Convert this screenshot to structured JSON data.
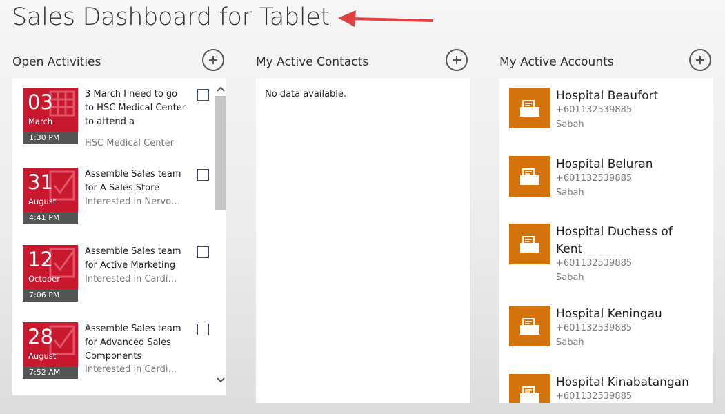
{
  "page": {
    "title": "Sales Dashboard for Tablet"
  },
  "columns": {
    "activities": {
      "header": "Open Activities",
      "items": [
        {
          "day": "03",
          "month": "March",
          "time": "1:30 PM",
          "title": "3 March I need to go to HSC Medical Center to attend a",
          "subtitle": "HSC Medical Center"
        },
        {
          "day": "31",
          "month": "August",
          "time": "4:41 PM",
          "title": "Assemble Sales team for A Sales Store",
          "subtitle": "Interested in Nervous"
        },
        {
          "day": "12",
          "month": "October",
          "time": "7:06 PM",
          "title": "Assemble Sales team for Active Marketing",
          "subtitle": "Interested in Cardiology"
        },
        {
          "day": "28",
          "month": "August",
          "time": "7:52 AM",
          "title": "Assemble Sales team for Advanced Sales Components",
          "subtitle": "Interested in Cardiology"
        }
      ]
    },
    "contacts": {
      "header": "My Active Contacts",
      "empty_text": "No data available."
    },
    "accounts": {
      "header": "My Active Accounts",
      "items": [
        {
          "name": "Hospital Beaufort",
          "phone": "+601132539885",
          "state": "Sabah"
        },
        {
          "name": "Hospital Beluran",
          "phone": "+601132539885",
          "state": "Sabah"
        },
        {
          "name": "Hospital Duchess of Kent",
          "phone": "+601132539885",
          "state": "Sabah"
        },
        {
          "name": "Hospital Keningau",
          "phone": "+601132539885",
          "state": "Sabah"
        },
        {
          "name": "Hospital Kinabatangan",
          "phone": "+601132539885",
          "state": ""
        }
      ]
    }
  },
  "icons": {
    "add": "plus-circle-icon",
    "activity_tile": "calendar-check-icon",
    "account_tile": "account-card-icon",
    "annotation": "red-arrow-icon"
  },
  "colors": {
    "activity_tile": "#c8182e",
    "time_bar": "#555555",
    "account_tile": "#d4720b",
    "annotation_arrow": "#e04040"
  }
}
